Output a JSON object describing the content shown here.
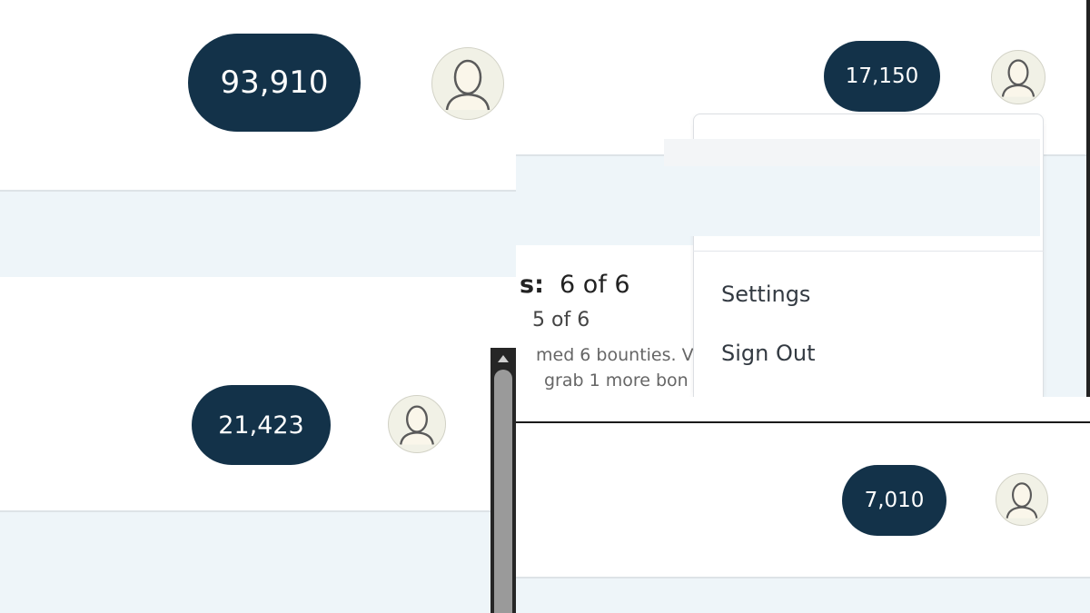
{
  "panels": {
    "top_left": {
      "points": "93,910"
    },
    "top_right": {
      "points": "17,150",
      "summary": {
        "title_fragment": "s:",
        "title_value": "6 of 6",
        "sub_value": "5 of 6",
        "message_line1": "med 6 bounties. V",
        "message_line2": "grab 1 more bon"
      },
      "menu": {
        "items": [
          "Settings",
          "Sign Out"
        ]
      }
    },
    "bottom_left": {
      "points": "21,423"
    },
    "bottom_right": {
      "points": "7,010"
    }
  },
  "icons": {
    "avatar": "user-avatar-icon",
    "scroll_up": "scroll-up-arrow-icon"
  },
  "colors": {
    "points_pill": "#133249",
    "band": "#eef5f9",
    "avatar_bg": "#f1f1e6"
  }
}
